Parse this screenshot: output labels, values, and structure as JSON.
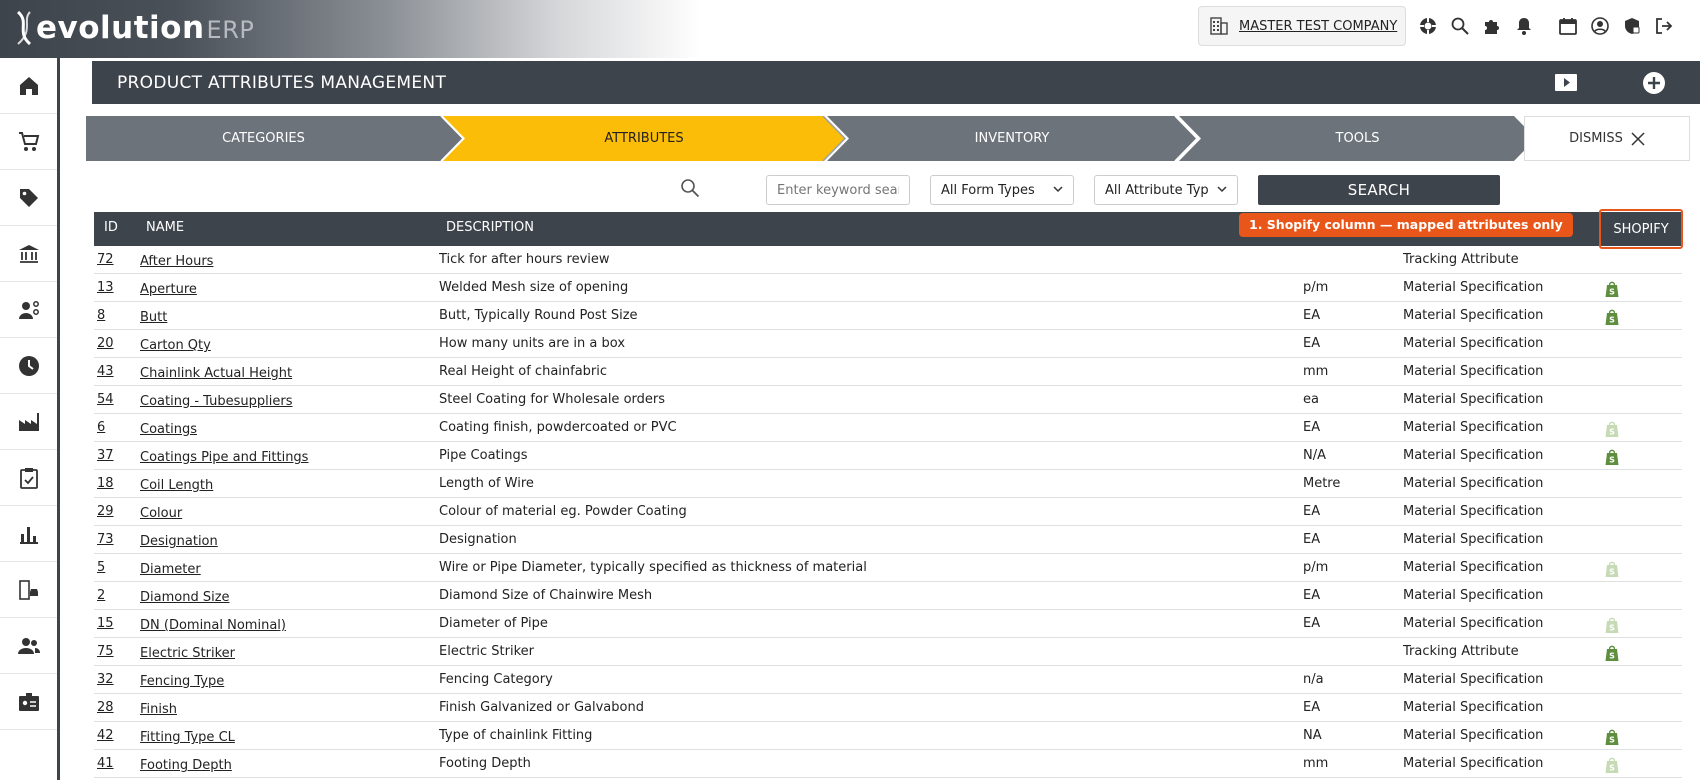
{
  "brand": {
    "name": "evolution",
    "suffix": "ERP"
  },
  "company": {
    "name": "MASTER TEST COMPANY"
  },
  "page": {
    "title": "PRODUCT ATTRIBUTES MANAGEMENT"
  },
  "steps": [
    {
      "label": "CATEGORIES",
      "active": false
    },
    {
      "label": "ATTRIBUTES",
      "active": true
    },
    {
      "label": "INVENTORY",
      "active": false
    },
    {
      "label": "TOOLS",
      "active": false
    }
  ],
  "dismiss_label": "DISMISS",
  "filters": {
    "keyword_placeholder": "Enter keyword search",
    "form_type": "All Form Types",
    "attribute_type": "All Attribute Types",
    "search_label": "SEARCH"
  },
  "table": {
    "headers": {
      "id": "ID",
      "name": "NAME",
      "description": "DESCRIPTION",
      "shopify": "SHOPIFY"
    },
    "callout": "1. Shopify column — mapped attributes only",
    "rows": [
      {
        "id": "72",
        "name": "After Hours",
        "description": "Tick for after hours review",
        "unit": "",
        "type": "Tracking Attribute",
        "shopify": "none"
      },
      {
        "id": "13",
        "name": "Aperture",
        "description": "Welded Mesh size of opening",
        "unit": "p/m",
        "type": "Material Specification",
        "shopify": "active"
      },
      {
        "id": "8",
        "name": "Butt",
        "description": "Butt, Typically Round Post Size",
        "unit": "EA",
        "type": "Material Specification",
        "shopify": "active"
      },
      {
        "id": "20",
        "name": "Carton Qty",
        "description": "How many units are in a box",
        "unit": "EA",
        "type": "Material Specification",
        "shopify": "none"
      },
      {
        "id": "43",
        "name": "Chainlink Actual Height",
        "description": "Real Height of chainfabric",
        "unit": "mm",
        "type": "Material Specification",
        "shopify": "none"
      },
      {
        "id": "54",
        "name": "Coating - Tubesuppliers",
        "description": "Steel Coating for Wholesale orders",
        "unit": "ea",
        "type": "Material Specification",
        "shopify": "none"
      },
      {
        "id": "6",
        "name": "Coatings",
        "description": "Coating finish, powdercoated or PVC",
        "unit": "EA",
        "type": "Material Specification",
        "shopify": "faded"
      },
      {
        "id": "37",
        "name": "Coatings Pipe and Fittings",
        "description": "Pipe Coatings",
        "unit": "N/A",
        "type": "Material Specification",
        "shopify": "active"
      },
      {
        "id": "18",
        "name": "Coil Length",
        "description": "Length of Wire",
        "unit": "Metre",
        "type": "Material Specification",
        "shopify": "none"
      },
      {
        "id": "29",
        "name": "Colour",
        "description": "Colour of material eg. Powder Coating",
        "unit": "EA",
        "type": "Material Specification",
        "shopify": "none"
      },
      {
        "id": "73",
        "name": "Designation",
        "description": "Designation",
        "unit": "EA",
        "type": "Material Specification",
        "shopify": "none"
      },
      {
        "id": "5",
        "name": "Diameter",
        "description": "Wire or Pipe Diameter, typically specified as thickness of material",
        "unit": "p/m",
        "type": "Material Specification",
        "shopify": "faded"
      },
      {
        "id": "2",
        "name": "Diamond Size",
        "description": "Diamond Size of Chainwire Mesh",
        "unit": "EA",
        "type": "Material Specification",
        "shopify": "none"
      },
      {
        "id": "15",
        "name": "DN (Dominal Nominal)",
        "description": "Diameter of Pipe",
        "unit": "EA",
        "type": "Material Specification",
        "shopify": "faded"
      },
      {
        "id": "75",
        "name": "Electric Striker",
        "description": "Electric Striker",
        "unit": "",
        "type": "Tracking Attribute",
        "shopify": "active"
      },
      {
        "id": "32",
        "name": "Fencing Type",
        "description": "Fencing Category",
        "unit": "n/a",
        "type": "Material Specification",
        "shopify": "none"
      },
      {
        "id": "28",
        "name": "Finish",
        "description": "Finish Galvanized or Galvabond",
        "unit": "EA",
        "type": "Material Specification",
        "shopify": "none"
      },
      {
        "id": "42",
        "name": "Fitting Type CL",
        "description": "Type of chainlink Fitting",
        "unit": "NA",
        "type": "Material Specification",
        "shopify": "active"
      },
      {
        "id": "41",
        "name": "Footing Depth",
        "description": "Footing Depth",
        "unit": "mm",
        "type": "Material Specification",
        "shopify": "faded"
      }
    ]
  },
  "colors": {
    "header_bg": "#3e444c",
    "active_step": "#fbbd08",
    "step_bg": "#6c737b",
    "callout": "#e8561a",
    "shopify_green": "#5e8e3e"
  }
}
